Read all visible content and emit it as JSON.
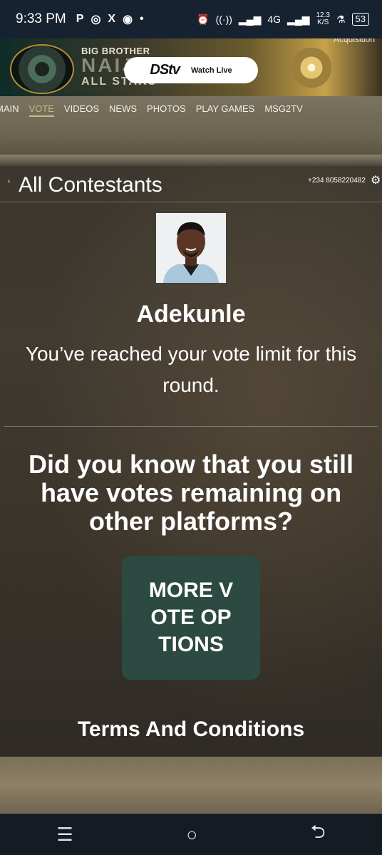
{
  "status_bar": {
    "time": "9:33 PM",
    "app_icons": [
      "P",
      "whatsapp-icon",
      "X",
      "chrome-icon",
      "•"
    ],
    "right_text": "4G",
    "speed": "12.3",
    "speed_unit": "K/S",
    "battery": "53"
  },
  "banner": {
    "title_top": "BIG BROTHER",
    "title_mid": "NAIJA",
    "title_bottom": "ALL STARS",
    "acquisition": "Acquisition",
    "dstv_logo": "DStv",
    "watch_live": "Watch Live"
  },
  "nav": {
    "items": [
      "MAIN",
      "VOTE",
      "VIDEOS",
      "NEWS",
      "PHOTOS",
      "PLAY GAMES",
      "MSG2TV"
    ],
    "active": "VOTE"
  },
  "header": {
    "back_caret": "‹",
    "title": "All Contestants",
    "phone": "+234 8058220482"
  },
  "contestant": {
    "name": "Adekunle",
    "message": "You’ve reached your vote limit for this round."
  },
  "promo": {
    "question": "Did you know that you still have votes remaining on other platforms?",
    "button_label": "MORE VOTE OPTIONS"
  },
  "terms": "Terms And Conditions",
  "colors": {
    "status_bar": "#172231",
    "button_bg": "#2c4a41",
    "nav_active": "#c9b98b"
  }
}
